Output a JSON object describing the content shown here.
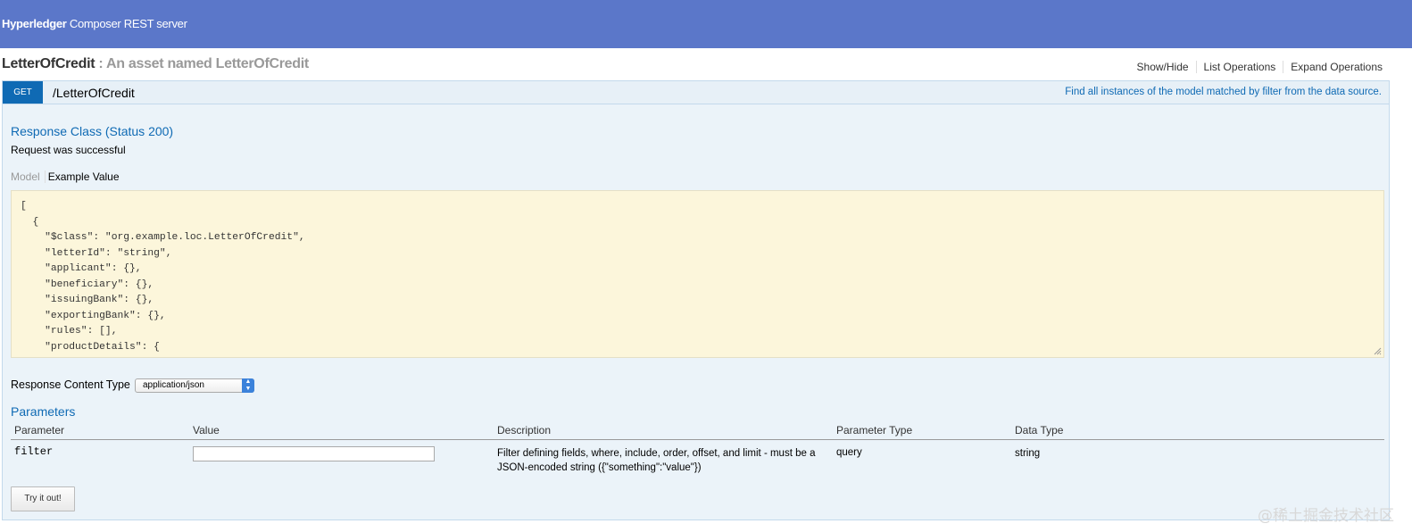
{
  "app": {
    "brand_bold": "Hyperledger",
    "brand_rest": " Composer REST server"
  },
  "resource": {
    "name": "LetterOfCredit",
    "separator": " : ",
    "description": "An asset named LetterOfCredit",
    "links": [
      "Show/Hide",
      "List Operations",
      "Expand Operations"
    ]
  },
  "operation": {
    "method": "GET",
    "path": "/LetterOfCredit",
    "summary": "Find all instances of the model matched by filter from the data source."
  },
  "response": {
    "heading": "Response Class (Status 200)",
    "message": "Request was successful",
    "tabs": {
      "model": "Model",
      "example": "Example Value"
    },
    "example_json": "[\n  {\n    \"$class\": \"org.example.loc.LetterOfCredit\",\n    \"letterId\": \"string\",\n    \"applicant\": {},\n    \"beneficiary\": {},\n    \"issuingBank\": {},\n    \"exportingBank\": {},\n    \"rules\": [],\n    \"productDetails\": {",
    "content_type_label": "Response Content Type",
    "content_type_value": "application/json"
  },
  "parameters": {
    "heading": "Parameters",
    "columns": [
      "Parameter",
      "Value",
      "Description",
      "Parameter Type",
      "Data Type"
    ],
    "rows": [
      {
        "name": "filter",
        "value": "",
        "description": "Filter defining fields, where, include, order, offset, and limit - must be a JSON-encoded string ({\"something\":\"value\"})",
        "param_type": "query",
        "data_type": "string"
      }
    ]
  },
  "try_button": "Try it out!",
  "watermark": "@稀土掘金技术社区",
  "colors": {
    "header_bg": "#5b77c9",
    "get_blue": "#0f6ab4",
    "op_bg": "#ebf3f9",
    "snippet_bg": "#fcf6db"
  },
  "icons": [
    "select-arrow-icon",
    "resize-grip-icon"
  ]
}
